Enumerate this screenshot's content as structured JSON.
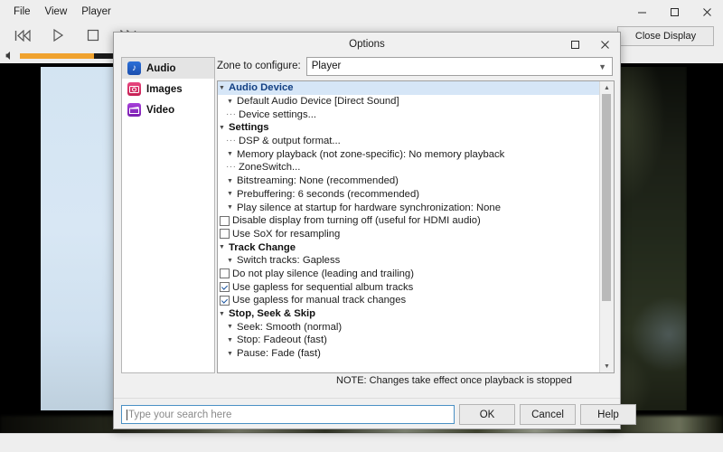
{
  "window": {
    "menus": [
      "File",
      "View",
      "Player"
    ],
    "controls": {
      "minimize": "minimize-icon",
      "maximize": "maximize-icon",
      "close": "close-icon"
    },
    "close_display_label": "Close Display",
    "transport": [
      "previous-track-icon",
      "play-icon",
      "stop-icon",
      "next-track-icon"
    ],
    "volume_icon": "speaker-icon",
    "seek_fill_percent": 24,
    "accent_color": "#f0a22e"
  },
  "dialog": {
    "title": "Options",
    "controls": {
      "maximize": "maximize-icon",
      "close": "close-icon"
    },
    "sidebar": [
      {
        "label": "Audio",
        "icon": "music-note-icon",
        "glyph": "♪",
        "selected": true
      },
      {
        "label": "Images",
        "icon": "camera-icon",
        "glyph": "◉",
        "selected": false
      },
      {
        "label": "Video",
        "icon": "clapperboard-icon",
        "glyph": "⬛",
        "selected": false
      }
    ],
    "zone": {
      "label": "Zone to configure:",
      "value": "Player",
      "caret": "chevron-down-icon"
    },
    "options": [
      {
        "kind": "group",
        "label": "Audio Device",
        "marker": "triangle",
        "selected": true
      },
      {
        "kind": "item",
        "label": "Default Audio Device [Direct Sound]",
        "marker": "triangle",
        "indent": 1
      },
      {
        "kind": "item",
        "label": "Device settings...",
        "marker": "dots",
        "indent": 1
      },
      {
        "kind": "group",
        "label": "Settings",
        "marker": "triangle",
        "selected": false
      },
      {
        "kind": "item",
        "label": "DSP & output format...",
        "marker": "dots",
        "indent": 1
      },
      {
        "kind": "item",
        "label": "Memory playback (not zone-specific): No memory playback",
        "marker": "triangle",
        "indent": 1
      },
      {
        "kind": "item",
        "label": "ZoneSwitch...",
        "marker": "dots",
        "indent": 1
      },
      {
        "kind": "item",
        "label": "Bitstreaming: None (recommended)",
        "marker": "triangle",
        "indent": 1
      },
      {
        "kind": "item",
        "label": "Prebuffering: 6 seconds (recommended)",
        "marker": "triangle",
        "indent": 1
      },
      {
        "kind": "item",
        "label": "Play silence at startup for hardware synchronization: None",
        "marker": "triangle",
        "indent": 1
      },
      {
        "kind": "check",
        "label": "Disable display from turning off (useful for HDMI audio)",
        "checked": false
      },
      {
        "kind": "check",
        "label": "Use SoX for resampling",
        "checked": false
      },
      {
        "kind": "group",
        "label": "Track Change",
        "marker": "triangle",
        "selected": false
      },
      {
        "kind": "item",
        "label": "Switch tracks: Gapless",
        "marker": "triangle",
        "indent": 1
      },
      {
        "kind": "check",
        "label": "Do not play silence (leading and trailing)",
        "checked": false
      },
      {
        "kind": "check",
        "label": "Use gapless for sequential album tracks",
        "checked": true
      },
      {
        "kind": "check",
        "label": "Use gapless for manual track changes",
        "checked": true
      },
      {
        "kind": "group",
        "label": "Stop, Seek & Skip",
        "marker": "triangle",
        "selected": false
      },
      {
        "kind": "item",
        "label": "Seek: Smooth (normal)",
        "marker": "triangle",
        "indent": 1
      },
      {
        "kind": "item",
        "label": "Stop: Fadeout (fast)",
        "marker": "triangle",
        "indent": 1
      },
      {
        "kind": "item",
        "label": "Pause: Fade (fast)",
        "marker": "triangle",
        "indent": 1
      },
      {
        "kind": "clipped",
        "label": "",
        "marker": "triangle",
        "indent": 1
      }
    ],
    "scrollbar": {
      "up": "scroll-up-arrow",
      "down": "scroll-down-arrow",
      "thumb_percent": 78
    },
    "note": "NOTE: Changes take effect once playback is stopped",
    "search": {
      "placeholder": "Type your search here",
      "value": ""
    },
    "buttons": {
      "ok": "OK",
      "cancel": "Cancel",
      "help": "Help"
    }
  }
}
